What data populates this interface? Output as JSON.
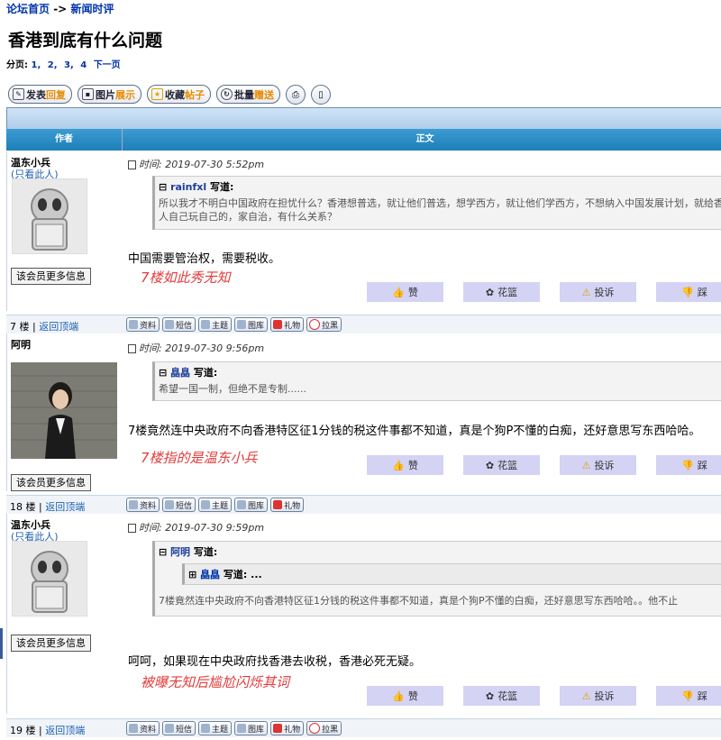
{
  "breadcrumb": {
    "home": "论坛首页",
    "sep": "->",
    "section": "新闻时评"
  },
  "page_title": "香港到底有什么问题",
  "pager": {
    "label": "分页:",
    "pages": [
      "1,",
      "2,",
      "3,",
      "4"
    ],
    "next": "下一页"
  },
  "toolbar": {
    "reply_a": "发表",
    "reply_b": "回复",
    "img_a": "图片",
    "img_b": "展示",
    "fav_a": "收藏",
    "fav_b": "帖子",
    "batch_a": "批量",
    "batch_b": "赠送"
  },
  "table": {
    "col_author": "作者",
    "col_body": "正文"
  },
  "common": {
    "more_info": "该会员更多信息",
    "only_this": "(只看此人)",
    "time_label": "时间:",
    "wrote": "写道:",
    "back_top": "返回顶端",
    "floor_sep": "楼 |",
    "actions": [
      "赞",
      "花篮",
      "投诉",
      "踩"
    ],
    "footer_btns": [
      "资料",
      "短信",
      "主题",
      "图库",
      "礼物",
      "拉黑"
    ]
  },
  "posts": [
    {
      "author": "温东小兵",
      "time": "2019-07-30 5:52pm",
      "quote_author": "rainfxl",
      "quote_text": "所以我才不明白中国政府在担忧什么？香港想普选，就让他们普选，想学西方，就让他们学西方，不想纳入中国发展计划，就给香港人自己玩自己的，家自治，有什么关系？",
      "body": "中国需要管治权，需要税收。",
      "annotation": "7楼如此秀无知",
      "floor": "7"
    },
    {
      "author": "阿明",
      "time": "2019-07-30 9:56pm",
      "quote_author": "皛皛",
      "quote_text": "希望一国一制，但绝不是专制......",
      "body": "7楼竟然连中央政府不向香港特区征1分钱的税这件事都不知道，真是个狗P不懂的白痴，还好意思写东西哈哈。",
      "annotation": "7楼指的是温东小兵",
      "floor": "18"
    },
    {
      "author": "温东小兵",
      "time": "2019-07-30 9:59pm",
      "quote_author": "阿明",
      "nested_author": "皛皛",
      "nested_text": "写道: ...",
      "quote_text": "7楼竟然连中央政府不向香港特区征1分钱的税这件事都不知道，真是个狗P不懂的白痴，还好意思写东西哈哈。。他不止",
      "body": "呵呵，如果现在中央政府找香港去收税，香港必死无疑。",
      "annotation": "被曝无知后尴尬闪烁其词",
      "floor": "19"
    }
  ]
}
